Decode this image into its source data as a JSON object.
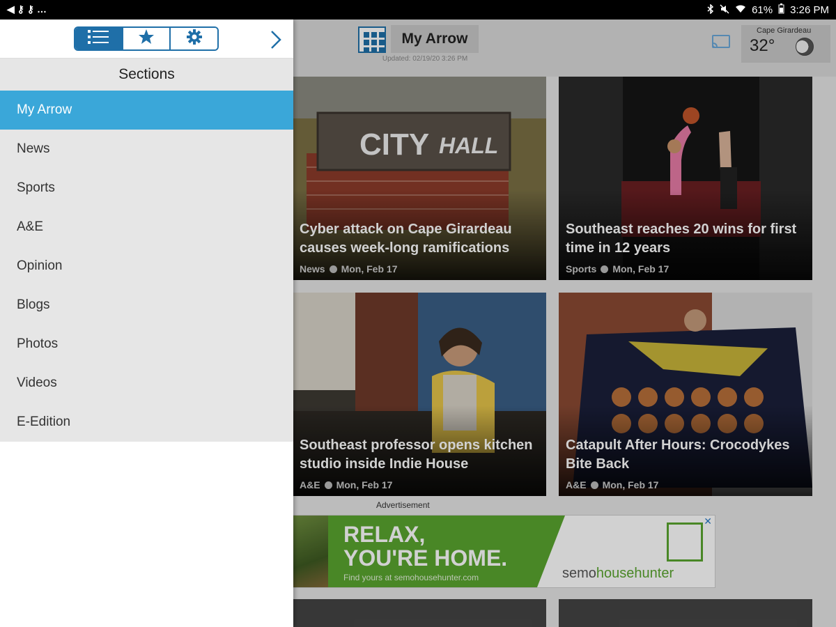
{
  "status_bar": {
    "left_icons": "◀ ⚷ ⚷ …",
    "battery": "61%",
    "time": "3:26 PM"
  },
  "header": {
    "title": "My Arrow",
    "updated": "Updated: 02/19/20 3:26 PM",
    "weather": {
      "city": "Cape Girardeau",
      "temp": "32°",
      "icon": "moon-icon"
    }
  },
  "cards": [
    {
      "title": "Cyber attack on Cape Girardeau causes week-long ramifications",
      "section": "News",
      "date": "Mon, Feb 17",
      "image": "city-hall-sign"
    },
    {
      "title": "Southeast reaches 20 wins for first time in 12 years",
      "section": "Sports",
      "date": "Mon, Feb 17",
      "image": "basketball-player"
    },
    {
      "title": "Southeast professor opens kitchen studio inside Indie House",
      "section": "A&E",
      "date": "Mon, Feb 17",
      "image": "kitchen-studio"
    },
    {
      "title": "Catapult After Hours: Crocodykes Bite Back",
      "section": "A&E",
      "date": "Mon, Feb 17",
      "image": "crocodile-banner"
    }
  ],
  "ad": {
    "label": "Advertisement",
    "headline1": "RELAX,",
    "headline2": "YOU'RE HOME.",
    "sub": "Find yours at semohousehunter.com",
    "brand_prefix": "semo",
    "brand_suffix": "househunter",
    "close": "✕"
  },
  "drawer": {
    "tabs": [
      {
        "name": "list-icon",
        "active": true
      },
      {
        "name": "star-icon",
        "active": false
      },
      {
        "name": "gear-icon",
        "active": false
      }
    ],
    "sections_title": "Sections",
    "items": [
      {
        "label": "My Arrow",
        "active": true
      },
      {
        "label": "News"
      },
      {
        "label": "Sports"
      },
      {
        "label": "A&E"
      },
      {
        "label": "Opinion"
      },
      {
        "label": "Blogs"
      },
      {
        "label": "Photos"
      },
      {
        "label": "Videos"
      },
      {
        "label": "E-Edition"
      }
    ]
  },
  "colors": {
    "accent": "#1f6fa8",
    "active_item": "#3aa7d9",
    "ad_green": "#5aa52f"
  }
}
